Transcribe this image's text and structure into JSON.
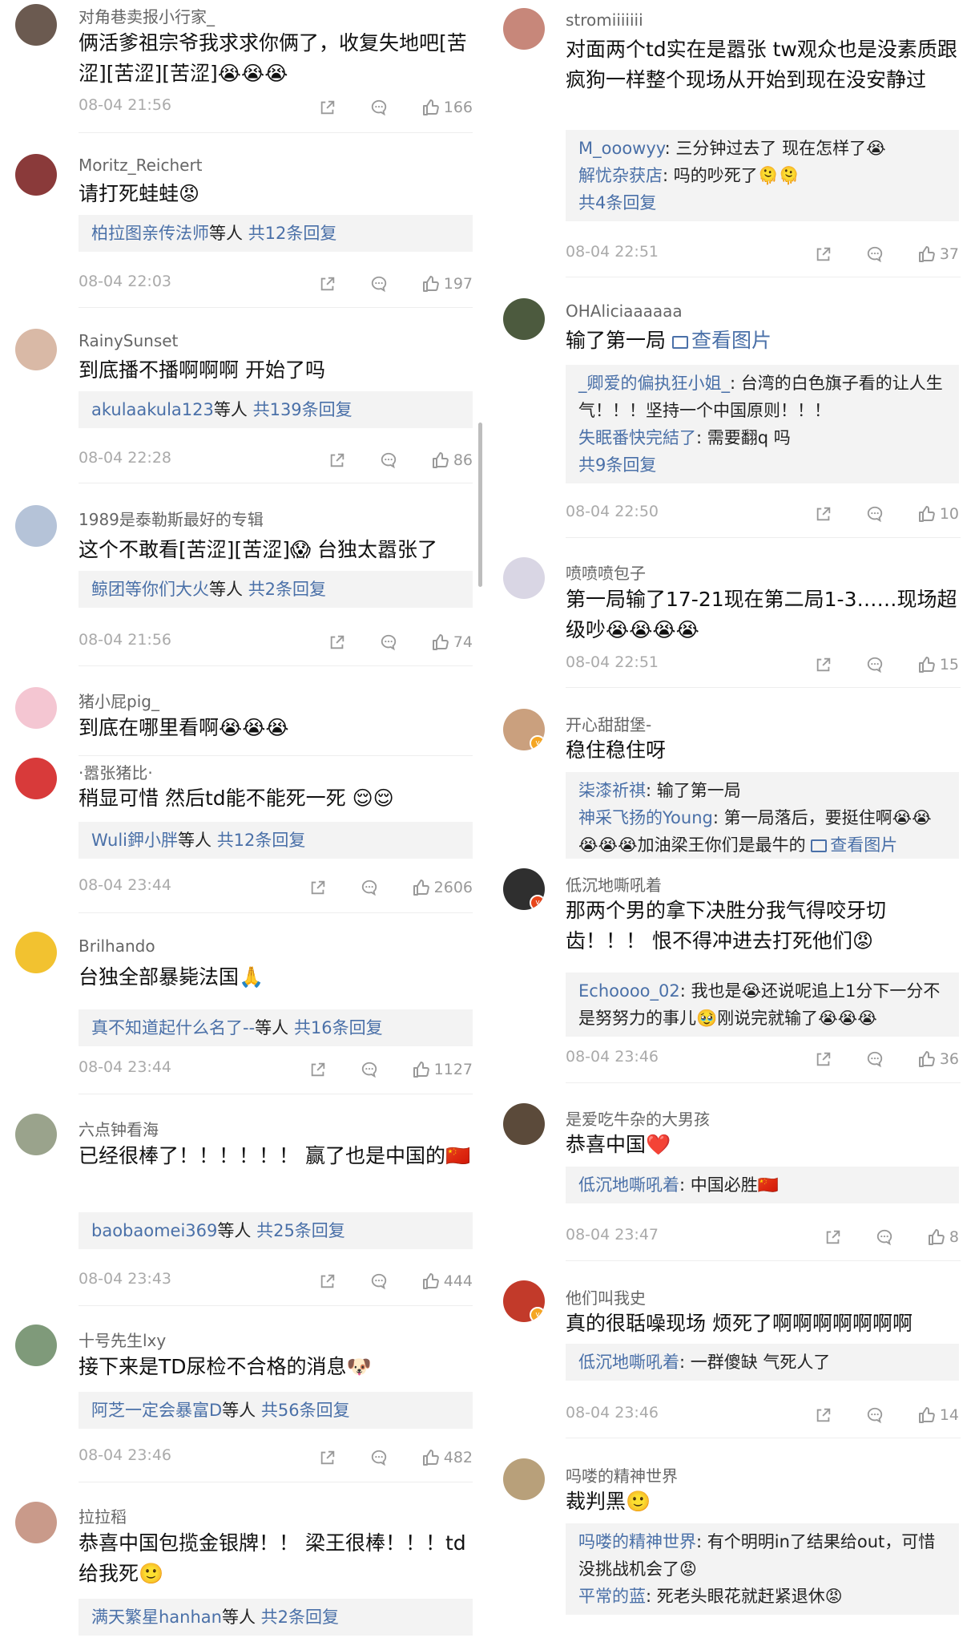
{
  "left": [
    {
      "user": "对角巷卖报小行家_",
      "avatar_color": "#6b5a50",
      "text": "俩活爹祖宗爷我求求你俩了，收复失地吧[苦涩][苦涩][苦涩]😭😭😭",
      "replies": null,
      "time": "08-04 21:56",
      "likes": "166"
    },
    {
      "user": "Moritz_Reichert",
      "avatar_color": "#8a3a3a",
      "text": "请打死蛙蛙😡",
      "replies": {
        "lines": [],
        "who": "柏拉图亲传法师",
        "suffix": "等人",
        "total": "共12条回复"
      },
      "time": "08-04 22:03",
      "likes": "197"
    },
    {
      "user": "RainySunset",
      "avatar_color": "#d9b9a6",
      "text": "到底播不播啊啊啊 开始了吗",
      "replies": {
        "lines": [],
        "who": "akulaakula123",
        "suffix": "等人",
        "total": "共139条回复"
      },
      "time": "08-04 22:28",
      "likes": "86"
    },
    {
      "user": "1989是泰勒斯最好的专辑",
      "avatar_color": "#b5c3d8",
      "text": "这个不敢看[苦涩][苦涩]😱 台独太嚣张了",
      "replies": {
        "lines": [],
        "who": "鲸团等你们大火",
        "suffix": "等人",
        "total": "共2条回复"
      },
      "time": "08-04 21:56",
      "likes": "74"
    },
    {
      "user": "猪小屁pig_",
      "avatar_color": "#f4c6d2",
      "text": "到底在哪里看啊😭😭😭",
      "replies": null,
      "time": "",
      "likes": ""
    },
    {
      "user": "·嚣张猪比·",
      "avatar_color": "#d83a3a",
      "text": "稍显可惜 然后td能不能死一死 😌😌",
      "replies": {
        "lines": [],
        "who": "Wuli鉀小胖",
        "suffix": "等人",
        "total": "共12条回复"
      },
      "time": "08-04 23:44",
      "likes": "2606"
    },
    {
      "user": "Brilhando",
      "avatar_color": "#f2c230",
      "text": "台独全部暴毙法国🙏",
      "replies": {
        "lines": [],
        "who": "真不知道起什么名了--",
        "suffix": "等人",
        "total": "共16条回复"
      },
      "time": "08-04 23:44",
      "likes": "1127"
    },
    {
      "user": "六点钟看海",
      "avatar_color": "#9aa38c",
      "text": "已经很棒了！！！！！！ 赢了也是中国的🇨🇳",
      "replies": {
        "lines": [],
        "who": "baobaomei369",
        "suffix": "等人",
        "total": "共25条回复"
      },
      "time": "08-04 23:43",
      "likes": "444"
    },
    {
      "user": "十号先生lxy",
      "avatar_color": "#7f9a7a",
      "text": "接下来是TD尿检不合格的消息🐶",
      "replies": {
        "lines": [],
        "who": "阿芝一定会暴富D",
        "suffix": "等人",
        "total": "共56条回复"
      },
      "time": "08-04 23:46",
      "likes": "482"
    },
    {
      "user": "拉拉稻",
      "avatar_color": "#c99a8a",
      "text": "恭喜中国包揽金银牌！！ 梁王很棒！！！td给我死🙂",
      "replies": {
        "lines": [],
        "who": "满天繁星hanhan",
        "suffix": "等人",
        "total": "共2条回复"
      },
      "time": "",
      "likes": ""
    }
  ],
  "right": [
    {
      "user": "stromiiiiiii",
      "avatar_color": "#c7877a",
      "text": "对面两个td实在是嚣张 tw观众也是没素质跟疯狗一样整个现场从开始到现在没安静过",
      "replies": {
        "lines": [
          {
            "who": "M_ooowyy",
            "text": ": 三分钟过去了 现在怎样了😭"
          },
          {
            "who": "解忧杂获店",
            "text": ": 吗的吵死了🫠🫠"
          }
        ],
        "who": "",
        "suffix": "",
        "total": "共4条回复"
      },
      "time": "08-04 22:51",
      "likes": "37"
    },
    {
      "user": "OHAliciaaaaaa",
      "avatar_color": "#4c5a3e",
      "text": "输了第一局",
      "pic": "查看图片",
      "replies": {
        "lines": [
          {
            "who": "_卿爱的偏执狂小姐_",
            "text": ": 台湾的白色旗子看的让人生气！！！坚持一个中国原则！！！"
          },
          {
            "who": "失眠番快完結了",
            "text": ": 需要翻q 吗"
          }
        ],
        "who": "",
        "suffix": "",
        "total": "共9条回复"
      },
      "time": "08-04 22:50",
      "likes": "10"
    },
    {
      "user": "喷喷喷包子",
      "avatar_color": "#d9d6e4",
      "text": "第一局输了17-21现在第二局1-3……现场超级吵😭😭😭😭",
      "replies": null,
      "time": "08-04 22:51",
      "likes": "15"
    },
    {
      "user": "开心甜甜堡-",
      "avatar_color": "#caa07e",
      "text": "稳住稳住呀",
      "replies": {
        "lines": [
          {
            "who": "柒漆祈祺",
            "text": ": 输了第一局"
          },
          {
            "who": "神采飞扬的Young",
            "text": ": 第一局落后，要挺住啊😭😭😭😭😭加油梁王你们是最牛的 ",
            "pic": "查看图片"
          }
        ],
        "who": "",
        "suffix": "",
        "total": ""
      },
      "time": "",
      "likes": ""
    },
    {
      "user": "低沉地嘶吼着",
      "avatar_color": "#2f2f2f",
      "text": "那两个男的拿下决胜分我气得咬牙切齿！！！ 恨不得冲进去打死他们😡",
      "replies": {
        "lines": [
          {
            "who": "Echoooo_02",
            "text": ": 我也是😭还说呢追上1分下一分不是努努力的事儿🥹刚说完就输了😭😭😭"
          }
        ],
        "who": "",
        "suffix": "",
        "total": ""
      },
      "time": "08-04 23:46",
      "likes": "36"
    },
    {
      "user": "是爱吃牛杂的大男孩",
      "avatar_color": "#5b4a3a",
      "text": "恭喜中国❤️",
      "replies": {
        "lines": [
          {
            "who": "低沉地嘶吼着",
            "text": ": 中国必胜🇨🇳"
          }
        ],
        "who": "",
        "suffix": "",
        "total": ""
      },
      "time": "08-04 23:47",
      "likes": "8"
    },
    {
      "user": "他们叫我史",
      "avatar_color": "#c23a2a",
      "text": "真的很聒噪现场 烦死了啊啊啊啊啊啊啊",
      "replies": {
        "lines": [
          {
            "who": "低沉地嘶吼着",
            "text": ": 一群傻缺 气死人了"
          }
        ],
        "who": "",
        "suffix": "",
        "total": ""
      },
      "time": "08-04 23:46",
      "likes": "14"
    },
    {
      "user": "吗喽的精神世界",
      "avatar_color": "#b8a07a",
      "text": "裁判黑🙂",
      "replies": {
        "lines": [
          {
            "who": "吗喽的精神世界",
            "text": ": 有个明明in了结果给out，可惜没挑战机会了😡"
          },
          {
            "who": "平常的蓝",
            "text": ": 死老头眼花就赶紧退休😡"
          }
        ],
        "who": "",
        "suffix": "",
        "total": ""
      },
      "time": "",
      "likes": ""
    }
  ]
}
